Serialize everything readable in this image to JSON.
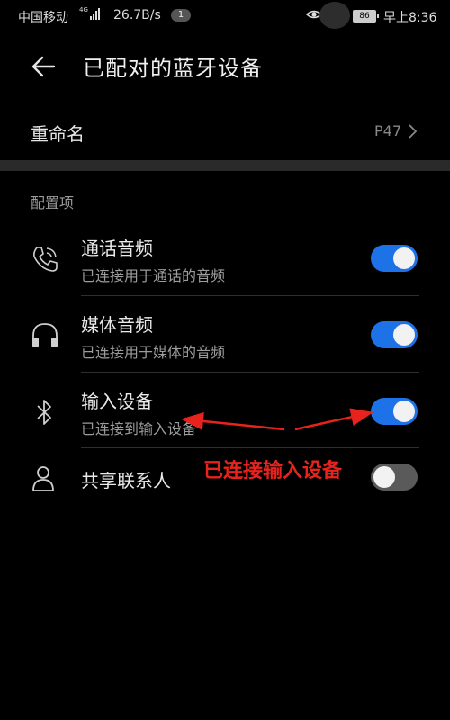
{
  "status_bar": {
    "carrier": "中国移动",
    "network": "4G",
    "speed": "26.7B/s",
    "notification_count": "1",
    "battery": "86",
    "time": "早上8:36"
  },
  "header": {
    "title": "已配对的蓝牙设备"
  },
  "rename": {
    "label": "重命名",
    "value": "P47"
  },
  "section_label": "配置项",
  "settings": [
    {
      "icon": "phone-icon",
      "title": "通话音频",
      "subtitle": "已连接用于通话的音频",
      "enabled": true
    },
    {
      "icon": "headphones-icon",
      "title": "媒体音频",
      "subtitle": "已连接用于媒体的音频",
      "enabled": true
    },
    {
      "icon": "bluetooth-icon",
      "title": "输入设备",
      "subtitle": "已连接到输入设备",
      "enabled": true
    },
    {
      "icon": "contact-icon",
      "title": "共享联系人",
      "subtitle": "",
      "enabled": false
    }
  ],
  "annotation": {
    "text": "已连接输入设备",
    "color": "#e8231d"
  },
  "colors": {
    "accent": "#1e72e8",
    "background": "#000000"
  }
}
